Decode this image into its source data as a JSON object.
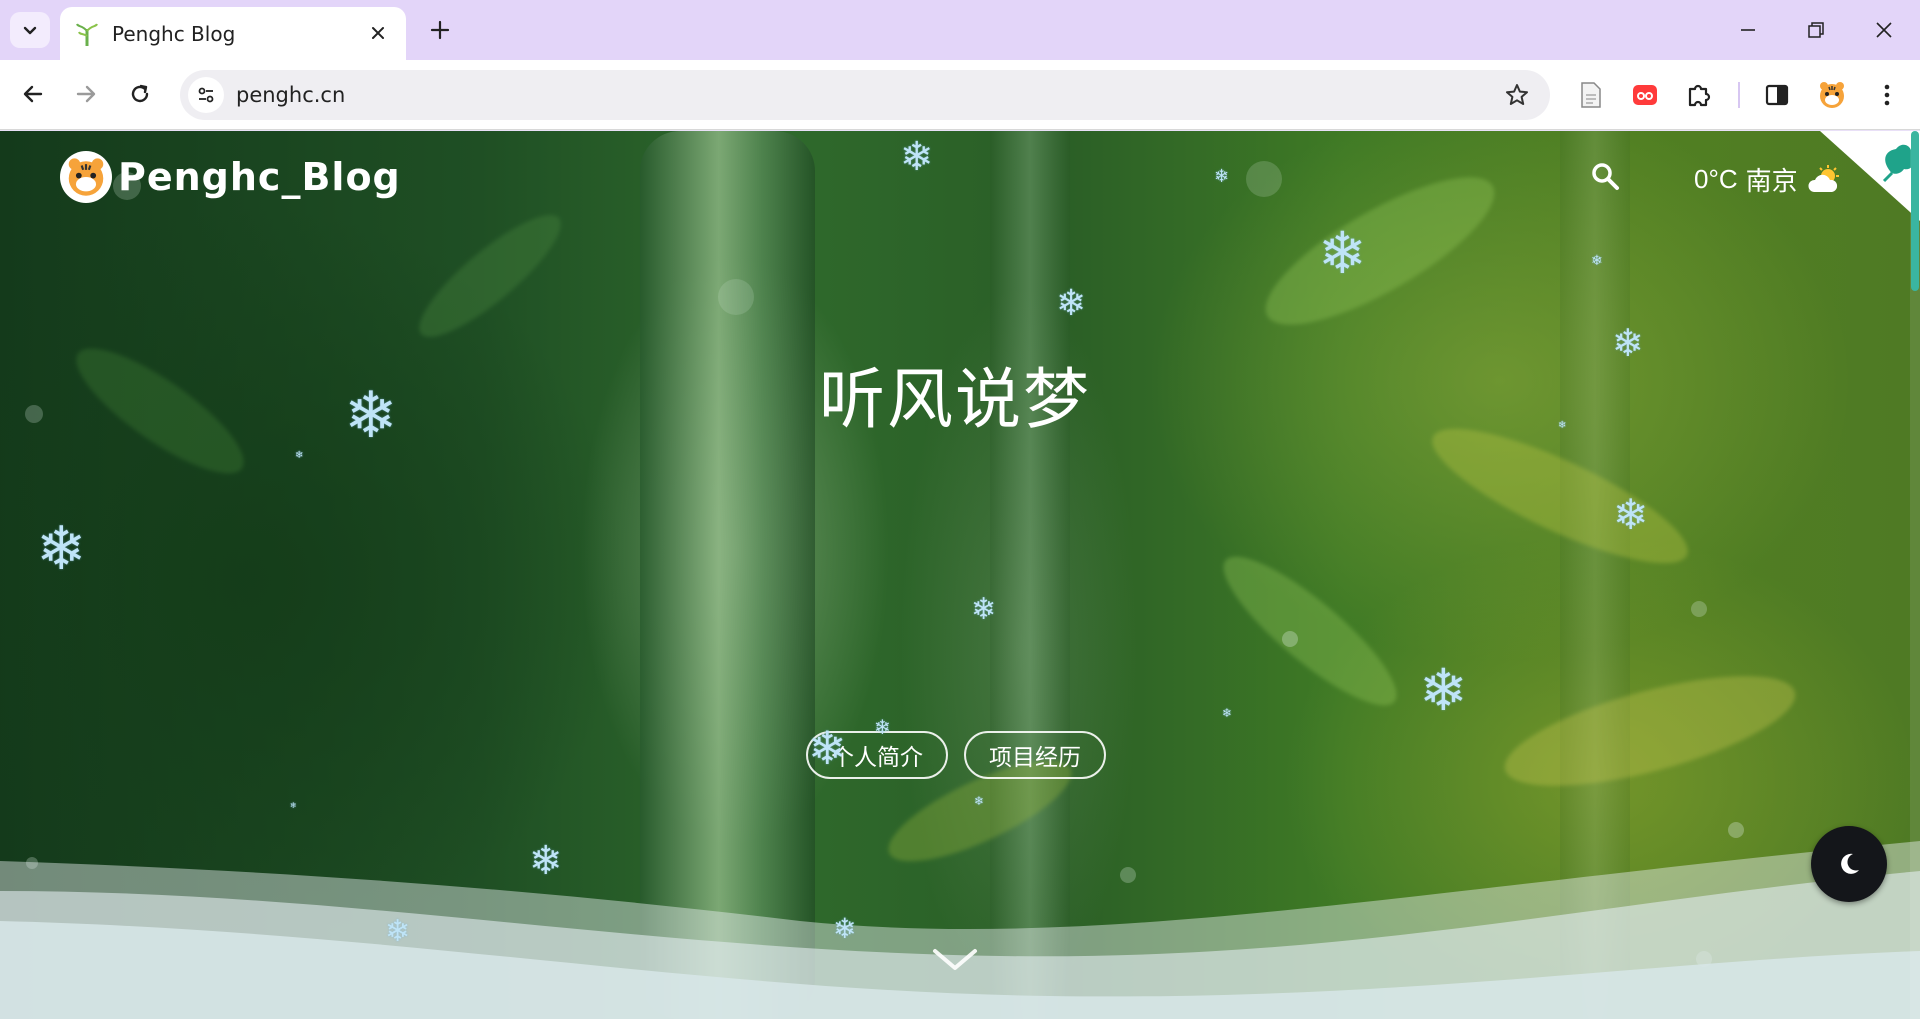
{
  "browser": {
    "tab": {
      "title": "Penghc Blog"
    },
    "address": {
      "url": "penghc.cn"
    }
  },
  "site": {
    "brand": "Penghc_Blog",
    "weather": {
      "temp": "0°C",
      "city": "南京"
    },
    "hero_title": "听风说梦",
    "buttons": [
      {
        "label": "个人简介"
      },
      {
        "label": "项目经历"
      }
    ]
  },
  "colors": {
    "tabstrip": "#e3d5f9",
    "scroll_thumb": "#3ab5a0",
    "snowflake": "#bfe4f7",
    "toggle_bg": "#14161a"
  },
  "icons": [
    "tab-search-icon",
    "bamboo-favicon",
    "close-icon",
    "plus-icon",
    "minimize-icon",
    "restore-icon",
    "window-close-icon",
    "back-icon",
    "forward-icon",
    "reload-icon",
    "site-info-icon",
    "star-icon",
    "reading-icon",
    "video-ext-icon",
    "puzzle-icon",
    "side-panel-icon",
    "tiger-avatar-icon",
    "menu-icon",
    "search-icon",
    "weather-icon",
    "moon-icon",
    "chevron-down-icon",
    "snowflake-icon"
  ]
}
